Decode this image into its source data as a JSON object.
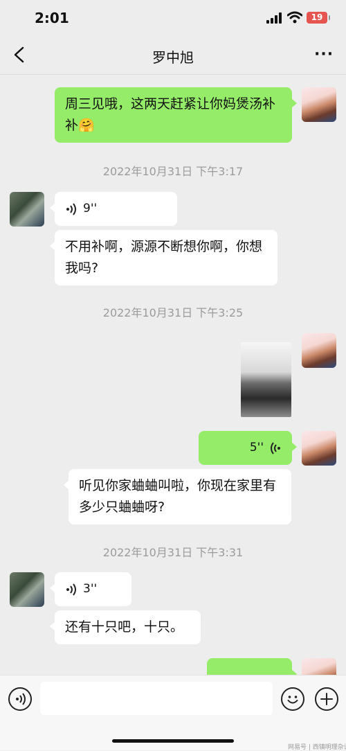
{
  "status_bar": {
    "time": "2:01",
    "battery": "19"
  },
  "header": {
    "title": "罗中旭",
    "more": "···"
  },
  "messages": {
    "m1": {
      "text": "周三见哦，这两天赶紧让你妈煲汤补补🤗"
    },
    "ts1": "2022年10月31日 下午3:17",
    "m2": {
      "duration": "9''"
    },
    "m3": {
      "text": "不用补啊，源源不断想你啊，你想我吗?"
    },
    "ts2": "2022年10月31日 下午3:25",
    "m5": {
      "duration": "5''"
    },
    "m6": {
      "text": "听见你家蛐蛐叫啦，你现在家里有多少只蛐蛐呀?"
    },
    "ts3": "2022年10月31日 下午3:31",
    "m7": {
      "duration": "3''"
    },
    "m8": {
      "text": "还有十只吧，十只。"
    }
  },
  "watermark": "网易号 | 西镇明理杂谈",
  "colors": {
    "sent_bubble": "#95ec69",
    "received_bubble": "#ffffff",
    "background": "#ededed"
  }
}
